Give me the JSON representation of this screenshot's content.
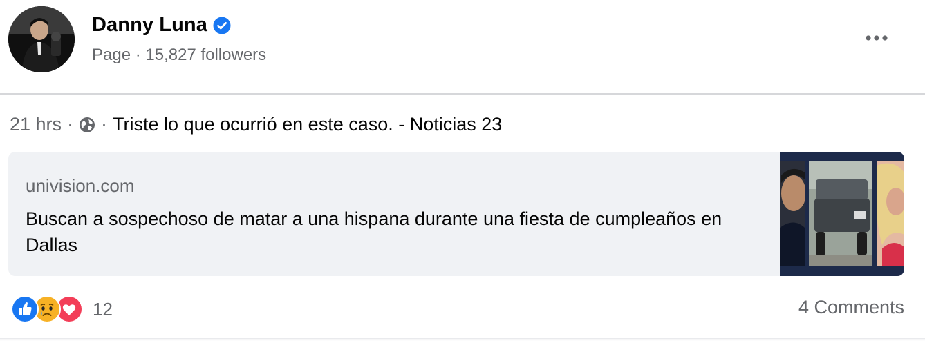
{
  "page": {
    "name": "Danny Luna",
    "meta": "Page · 15,827 followers"
  },
  "post": {
    "time": "21 hrs",
    "sep1": "·",
    "sep2": "·",
    "text": "Triste lo que ocurrió en este caso. - Noticias 23"
  },
  "link_card": {
    "domain": "univision.com",
    "headline": "Buscan a sospechoso de matar a una hispana durante una fiesta de cumpleaños en Dallas"
  },
  "footer": {
    "reaction_count": "12",
    "comments": "4 Comments"
  },
  "icons": {
    "verified": "verified-badge-icon",
    "globe": "globe-icon",
    "more": "more-options-icon",
    "reactions": [
      "like-reaction-icon",
      "sad-reaction-icon",
      "love-reaction-icon"
    ]
  },
  "colors": {
    "verified": "#1877f2",
    "like": "#1877f2",
    "love": "#f33e58",
    "sad": "#f7b125",
    "card_bg": "#f0f2f5"
  }
}
